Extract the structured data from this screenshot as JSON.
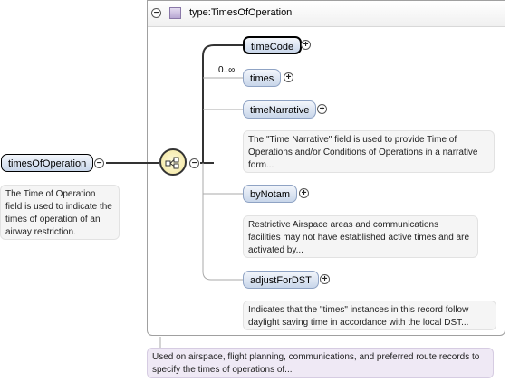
{
  "type_box": {
    "title": "type:TimesOfOperation"
  },
  "root": {
    "label": "timesOfOperation",
    "note": "The Time of Operation field is used to indicate the times of operation of an airway restriction."
  },
  "children": [
    {
      "label": "timeCode",
      "multiplicity": "",
      "note": ""
    },
    {
      "label": "times",
      "multiplicity": "0..∞",
      "note": ""
    },
    {
      "label": "timeNarrative",
      "multiplicity": "",
      "note": "The \"Time Narrative\" field is used to provide Time of Operations and/or Conditions of Operations in a narrative form..."
    },
    {
      "label": "byNotam",
      "multiplicity": "",
      "note": "Restrictive Airspace areas and communications facilities may not have established active times and are activated by..."
    },
    {
      "label": "adjustForDST",
      "multiplicity": "",
      "note": "Indicates that the \"times\" instances in this record follow daylight saving time in accordance with the local DST..."
    }
  ],
  "type_note": "Used on airspace, flight planning, communications, and preferred route records to specify the times of operations of...",
  "glyphs": {
    "plus": "+",
    "minus": "−"
  }
}
